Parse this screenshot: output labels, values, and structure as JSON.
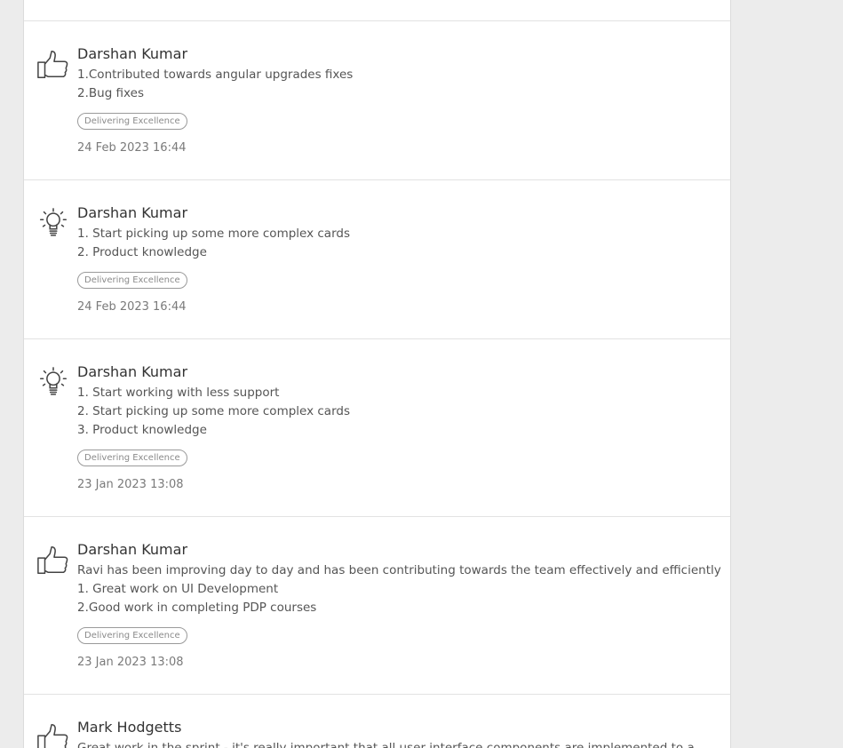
{
  "feed": {
    "items": [
      {
        "icon": "thumbs-up-icon",
        "author": "Darshan Kumar",
        "lines": [
          "1.Contributed towards angular upgrades fixes",
          "2.Bug fixes"
        ],
        "tag": "Delivering Excellence",
        "timestamp": "24 Feb 2023 16:44"
      },
      {
        "icon": "lightbulb-icon",
        "author": "Darshan Kumar",
        "lines": [
          "1. Start picking up some more complex cards",
          "2. Product knowledge"
        ],
        "tag": "Delivering Excellence",
        "timestamp": "24 Feb 2023 16:44"
      },
      {
        "icon": "lightbulb-icon",
        "author": "Darshan Kumar",
        "lines": [
          "1. Start working with less support",
          "2. Start picking up some more complex cards",
          "3. Product knowledge"
        ],
        "tag": "Delivering Excellence",
        "timestamp": "23 Jan 2023 13:08"
      },
      {
        "icon": "thumbs-up-icon",
        "author": "Darshan Kumar",
        "lines": [
          "Ravi has been improving day to day and has been contributing towards the team effectively and efficiently",
          "1. Great work on UI Development",
          "2.Good work in completing PDP courses"
        ],
        "tag": "Delivering Excellence",
        "timestamp": "23 Jan 2023 13:08"
      },
      {
        "icon": "thumbs-up-icon",
        "author": "Mark Hodgetts",
        "lines": [
          "Great work in the sprint - it's really important that all user interface components are implemented to a"
        ],
        "tag": "",
        "timestamp": ""
      }
    ]
  }
}
